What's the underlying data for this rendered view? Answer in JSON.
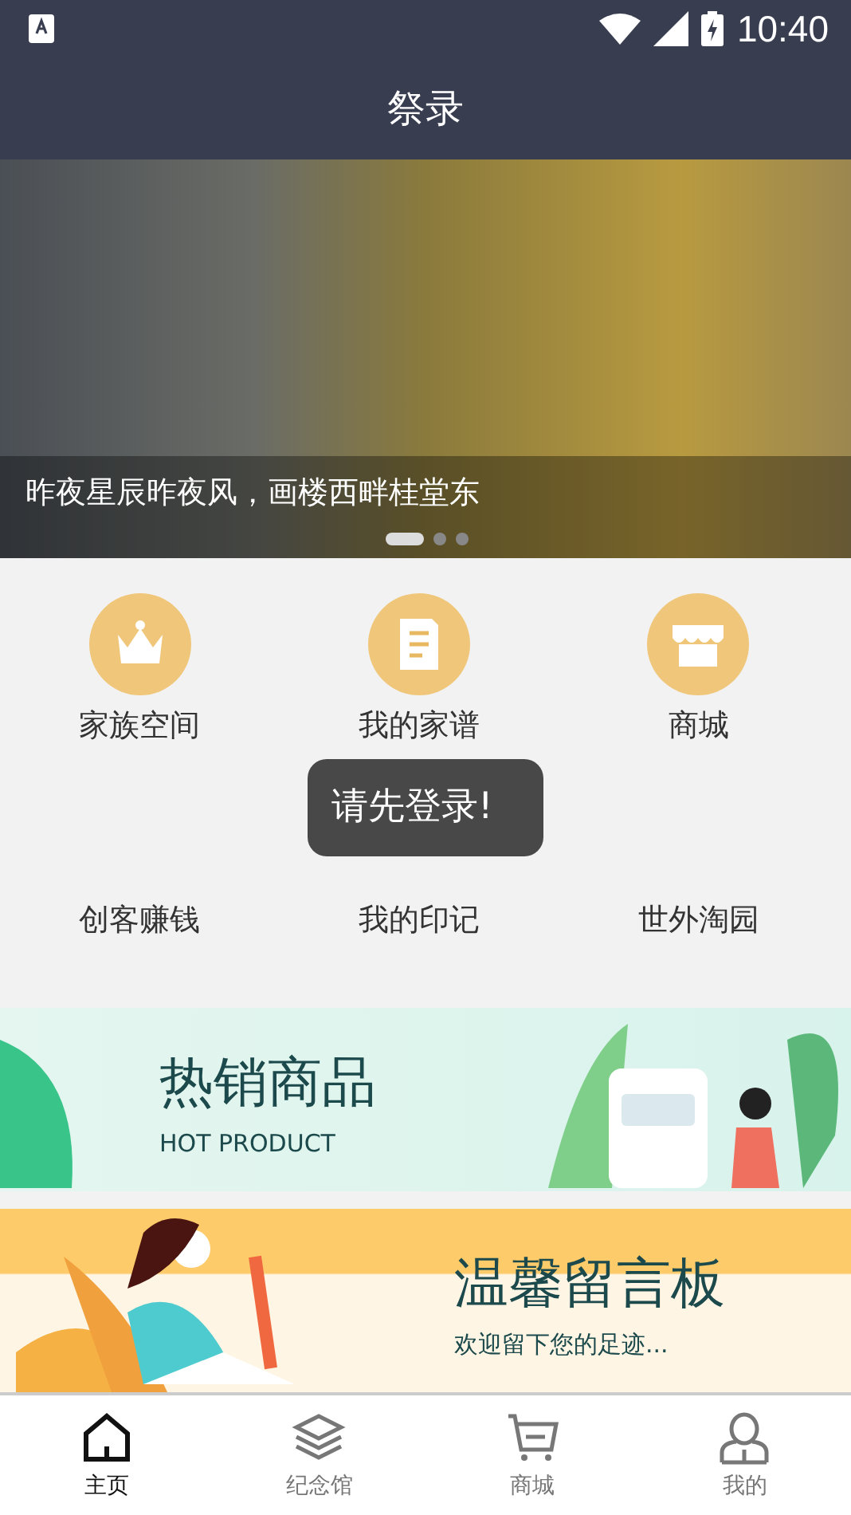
{
  "status_bar": {
    "time": "10:40"
  },
  "title_bar": {
    "title": "祭录"
  },
  "hero": {
    "caption": "昨夜星辰昨夜风，画楼西畔桂堂东",
    "dots": [
      {
        "selected": true
      },
      {
        "selected": false
      },
      {
        "selected": false
      }
    ]
  },
  "features": [
    {
      "label": "家族空间"
    },
    {
      "label": "我的家谱"
    },
    {
      "label": "商城"
    },
    {
      "label": "创客赚钱"
    },
    {
      "label": "我的印记"
    },
    {
      "label": "世外淘园"
    }
  ],
  "promos": [
    {
      "kind": "green",
      "title": "热销商品",
      "subtitle": "HOT PRODUCT"
    },
    {
      "kind": "orange",
      "title": "温馨留言板",
      "subtitle": "欢迎留下您的足迹..."
    }
  ],
  "toast": {
    "text": "请先登录!"
  },
  "tabs": [
    {
      "label": "主页",
      "selected": true
    },
    {
      "label": "纪念馆",
      "selected": false
    },
    {
      "label": "商城",
      "selected": false
    },
    {
      "label": "我的",
      "selected": false
    }
  ]
}
